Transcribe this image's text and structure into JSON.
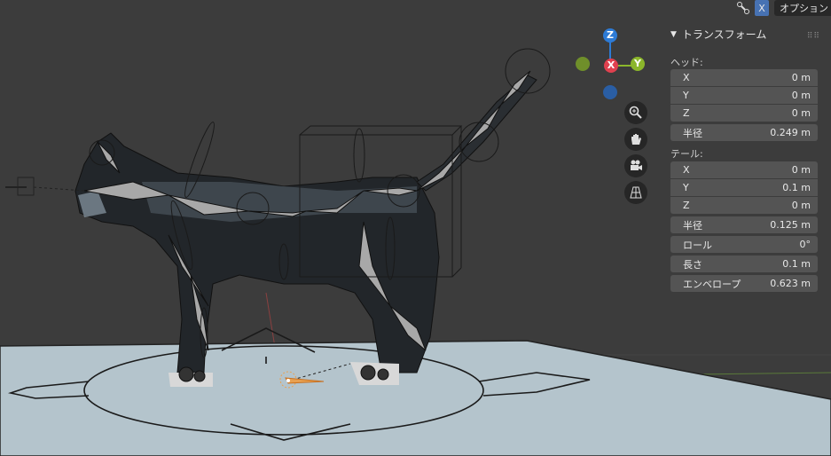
{
  "header": {
    "overlay_toggle_icon": "bone-overlay-icon",
    "x_ray_label": "X",
    "options_label": "オプション"
  },
  "gizmo": {
    "z_label": "Z",
    "x_label": "X",
    "y_label": "Y",
    "colors": {
      "x": "#e0414f",
      "y": "#8bb62b",
      "z": "#2d7bd6",
      "neg_y": "#6f8f2a",
      "neg_z": "#2a5ea4"
    }
  },
  "nav_buttons": [
    "zoom-icon",
    "pan-hand-icon",
    "camera-icon",
    "grid-perspective-icon"
  ],
  "panel": {
    "title": "トランスフォーム",
    "head_label": "ヘッド:",
    "head": [
      {
        "label": "X",
        "value": "0 m"
      },
      {
        "label": "Y",
        "value": "0 m"
      },
      {
        "label": "Z",
        "value": "0 m"
      }
    ],
    "head_radius": {
      "label": "半径",
      "value": "0.249 m"
    },
    "tail_label": "テール:",
    "tail": [
      {
        "label": "X",
        "value": "0 m"
      },
      {
        "label": "Y",
        "value": "0.1 m"
      },
      {
        "label": "Z",
        "value": "0 m"
      }
    ],
    "tail_radius": {
      "label": "半径",
      "value": "0.125 m"
    },
    "roll": {
      "label": "ロール",
      "value": "0°"
    },
    "length": {
      "label": "長さ",
      "value": "0.1 m"
    },
    "envelope": {
      "label": "エンベロープ",
      "value": "0.623 m"
    }
  }
}
